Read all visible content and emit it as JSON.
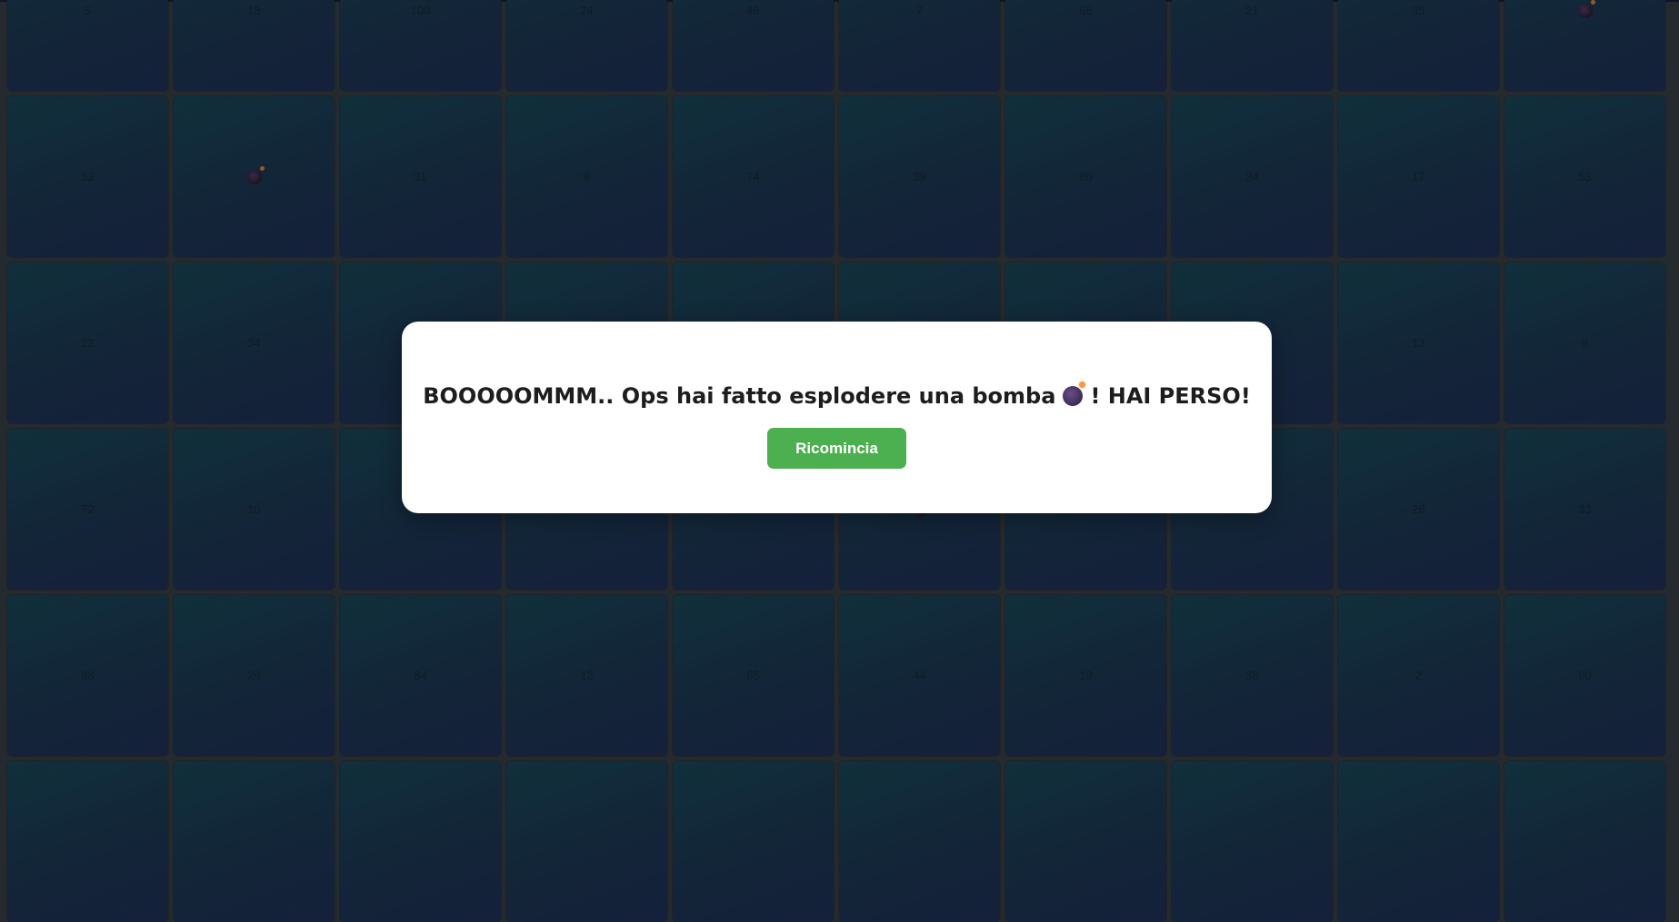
{
  "board": {
    "rows": [
      [
        "5",
        "18",
        "100",
        "24",
        "46",
        "7",
        "68",
        "21",
        "35",
        "💣"
      ],
      [
        "53",
        "💣",
        "31",
        "8",
        "74",
        "39",
        "86",
        "24",
        "17",
        "53"
      ],
      [
        "22",
        "34",
        "",
        "",
        "",
        "",
        "",
        "",
        "13",
        "8"
      ],
      [
        "72",
        "10",
        "",
        "",
        "",
        "💣",
        "",
        "",
        "26",
        "33"
      ],
      [
        "88",
        "26",
        "84",
        "12",
        "65",
        "44",
        "19",
        "38",
        "2",
        "90"
      ],
      [
        "",
        "",
        "",
        "",
        "",
        "",
        "",
        "",
        "",
        ""
      ]
    ]
  },
  "modal": {
    "message_before": "BOOOOOMMM.. Ops hai fatto esplodere una bomba",
    "message_icon": "bomb-icon",
    "message_after": "! HAI PERSO!",
    "restart_label": "Ricomincia"
  },
  "colors": {
    "background": "#252a2f",
    "cell": "#132538",
    "button": "#4caf50",
    "modal": "#ffffff"
  }
}
